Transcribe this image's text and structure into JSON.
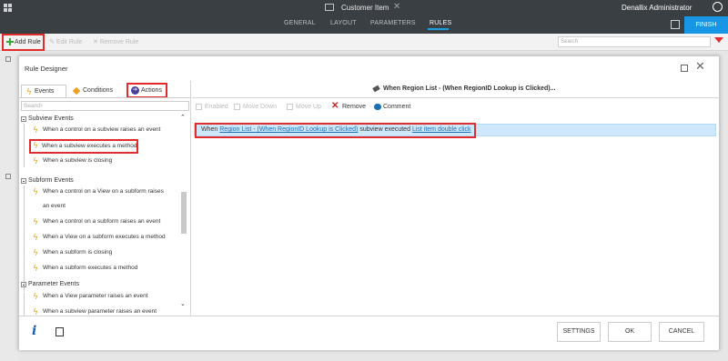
{
  "app": {
    "title": "Customer Item",
    "user": "Denallix Administrator",
    "tabs": [
      "GENERAL",
      "LAYOUT",
      "PARAMETERS",
      "RULES"
    ],
    "active_tab": "RULES",
    "finish_label": "FINISH"
  },
  "toolbar": {
    "add_rule": "Add Rule",
    "edit_rule": "Edit Rule",
    "remove_rule": "Remove Rule",
    "search_placeholder": "Search"
  },
  "dialog": {
    "title": "Rule Designer",
    "left_tabs": {
      "events": "Events",
      "conditions": "Conditions",
      "actions": "Actions"
    },
    "search_placeholder": "Search",
    "groups": [
      {
        "label": "Subview Events",
        "items": [
          "When a control on a subview raises an event",
          "When a subview executes a method",
          "When a subview is closing"
        ]
      },
      {
        "label": "Subform Events",
        "items": [
          "When a control on a View on a subform raises",
          "an event",
          "When a control on a subform raises an event",
          "When a View on a subform executes a method",
          "When a subform is closing",
          "When a subform executes a method"
        ]
      },
      {
        "label": "Parameter Events",
        "items": [
          "When a View parameter raises an event",
          "When a subview parameter raises an event"
        ]
      }
    ],
    "right_header": "When Region List - (When RegionID Lookup is Clicked)...",
    "right_toolbar": {
      "enabled": "Enabled",
      "move_down": "Move Down",
      "move_up": "Move Up",
      "remove": "Remove",
      "comment": "Comment"
    },
    "rule": {
      "prefix": "When",
      "link1": "Region List - (When RegionID Lookup is Clicked)",
      "middle": "subview executed",
      "link2": "List item double click"
    },
    "footer": {
      "settings": "SETTINGS",
      "ok": "OK",
      "cancel": "CANCEL"
    }
  },
  "colors": {
    "topbar": "#3a3f44",
    "accent": "#1696e5",
    "highlight_border": "#e02c2c",
    "rule_row": "#cfe7fb",
    "link": "#1a6fb5"
  }
}
